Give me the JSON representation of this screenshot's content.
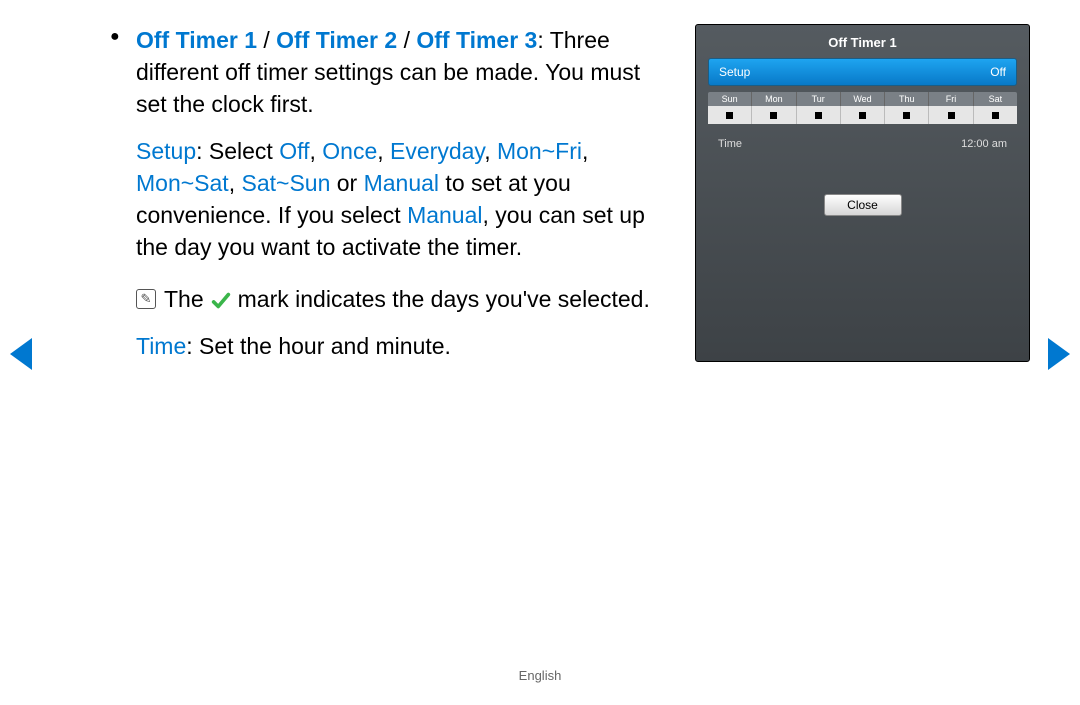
{
  "text": {
    "heading_parts": {
      "t1": "Off Timer 1",
      "t2": "Off Timer 2",
      "t3": "Off Timer 3"
    },
    "heading_after": ": Three different off timer settings can be made. You must set the clock first.",
    "setup_label": "Setup",
    "setup_after": ": Select ",
    "opt_off": "Off",
    "opt_once": "Once",
    "opt_everyday": "Everyday",
    "opt_monfri": "Mon~Fri",
    "opt_monsat": "Mon~Sat",
    "opt_satsun": "Sat~Sun",
    "opt_or": " or ",
    "opt_manual": "Manual",
    "setup_tail1": " to set at you convenience. If you select ",
    "setup_tail_manual": "Manual",
    "setup_tail2": ", you can set up the day you want to activate the timer.",
    "note_pre": "The ",
    "note_post": " mark indicates the days you've selected.",
    "time_label": "Time",
    "time_after": ": Set the hour and minute."
  },
  "panel": {
    "title": "Off Timer 1",
    "setup_label": "Setup",
    "setup_value": "Off",
    "days": [
      "Sun",
      "Mon",
      "Tur",
      "Wed",
      "Thu",
      "Fri",
      "Sat"
    ],
    "time_label": "Time",
    "time_value": "12:00 am",
    "close": "Close"
  },
  "footer": "English"
}
